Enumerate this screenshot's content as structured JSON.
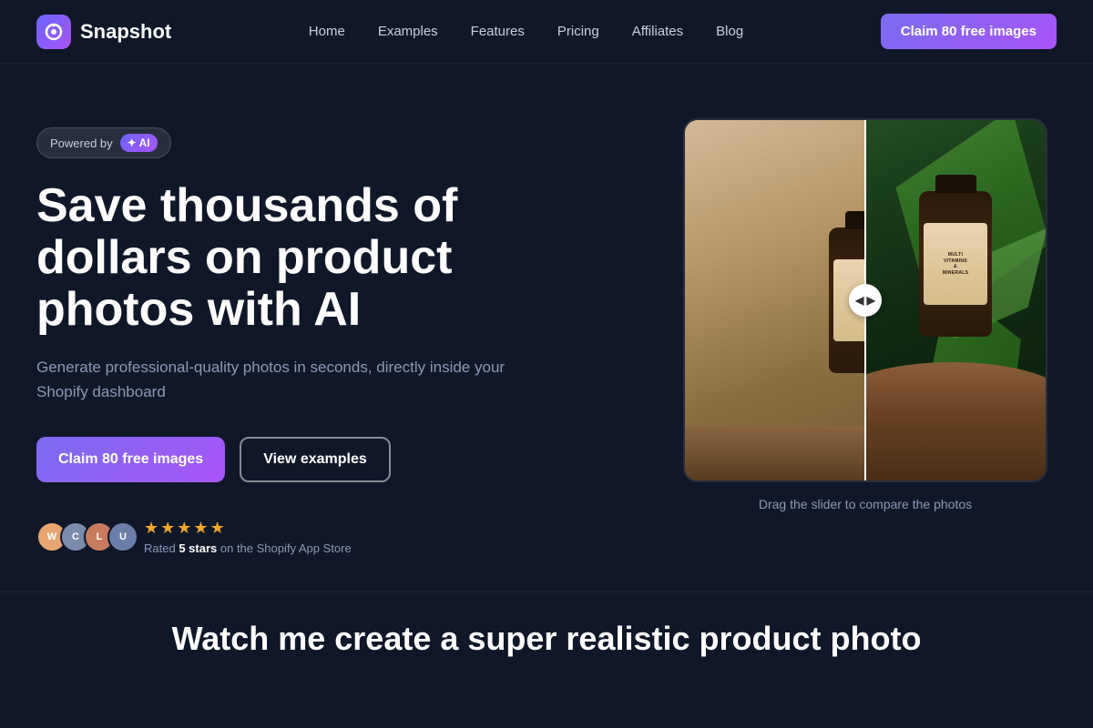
{
  "nav": {
    "logo_text": "Snapshot",
    "links": [
      {
        "label": "Home",
        "id": "home"
      },
      {
        "label": "Examples",
        "id": "examples"
      },
      {
        "label": "Features",
        "id": "features"
      },
      {
        "label": "Pricing",
        "id": "pricing"
      },
      {
        "label": "Affiliates",
        "id": "affiliates"
      },
      {
        "label": "Blog",
        "id": "blog"
      }
    ],
    "cta_label": "Claim 80 free images"
  },
  "hero": {
    "powered_by": "Powered by",
    "ai_label": "✦ AI",
    "title": "Save thousands of dollars on product photos with AI",
    "subtitle": "Generate professional-quality photos in seconds, directly inside your Shopify dashboard",
    "btn_claim": "Claim 80 free images",
    "btn_examples": "View examples",
    "rating_label": "Rated",
    "rating_stars": "5 stars",
    "rating_suffix": "on the Shopify App Store"
  },
  "comparison": {
    "caption": "Drag the slider to compare the photos",
    "label_text1": "MULTI",
    "label_text2": "VITAMINS",
    "label_text3": "& MINERALS"
  },
  "bottom": {
    "title": "Watch me create a super realistic product photo"
  },
  "colors": {
    "bg": "#0f1729",
    "accent": "#7c6cf0",
    "accent2": "#a855f7"
  }
}
